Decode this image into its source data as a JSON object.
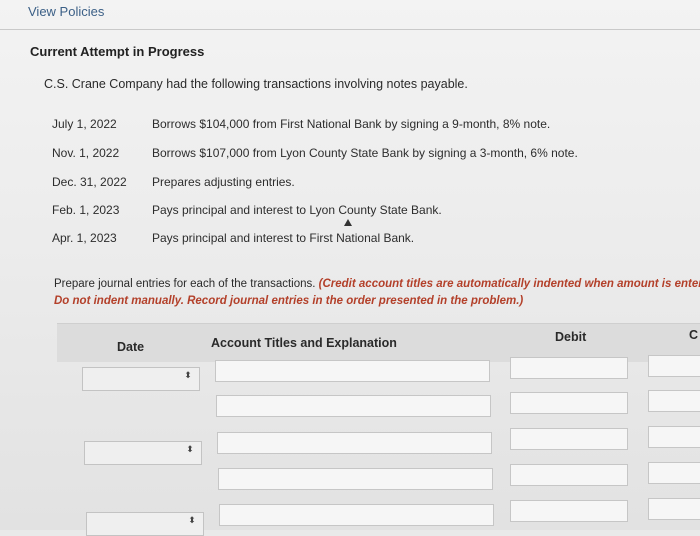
{
  "header": {
    "view_policies_label": "View Policies"
  },
  "attempt": {
    "title": "Current Attempt in Progress"
  },
  "problem": {
    "intro": "C.S. Crane Company had the following transactions involving notes payable.",
    "transactions": [
      {
        "date": "July 1, 2022",
        "description": "Borrows $104,000 from First National Bank by signing a 9-month, 8% note."
      },
      {
        "date": "Nov. 1, 2022",
        "description": "Borrows $107,000 from Lyon County State Bank by signing a 3-month, 6% note."
      },
      {
        "date": "Dec. 31, 2022",
        "description": "Prepares adjusting entries."
      },
      {
        "date": "Feb. 1, 2023",
        "description": "Pays principal and interest to Lyon County State Bank."
      },
      {
        "date": "Apr. 1, 2023",
        "description": "Pays principal and interest to First National Bank."
      }
    ]
  },
  "instructions": {
    "plain": "Prepare journal entries for each of the transactions. ",
    "emphasis_line1": "(Credit account titles are automatically indented when amount is entere",
    "emphasis_line2": "Do not indent manually. Record journal entries in the order presented in the problem.)"
  },
  "journal_table": {
    "headers": {
      "date": "Date",
      "account": "Account Titles and Explanation",
      "debit": "Debit",
      "credit": "C"
    },
    "date_spinner_glyph": "⬍"
  }
}
